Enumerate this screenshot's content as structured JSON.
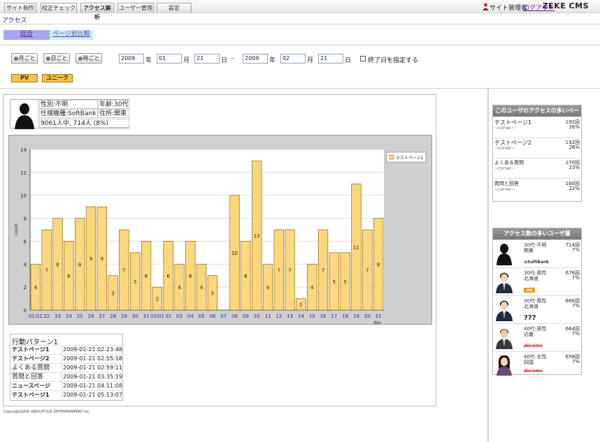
{
  "nav": {
    "tabs": [
      "サイト制作",
      "校正チェック",
      "アクセス解析",
      "ユーザー管理",
      "設定"
    ],
    "user_label": "サイト管理者",
    "logout_label": "ログアウト",
    "brand": "ZEKE CMS"
  },
  "section_title": "アクセス",
  "subtabs": [
    "総合",
    "ページ別比較"
  ],
  "filters": {
    "period_buttons": [
      "月ごと",
      "日ごと",
      "時ごと"
    ],
    "from": {
      "year": "2009",
      "month": "01",
      "day": "21"
    },
    "to": {
      "year": "2009",
      "month": "02",
      "day": "21"
    },
    "year_label": "年",
    "month_label": "月",
    "day_label": "日",
    "dash": "–",
    "enddate_label": "終了日を指定する",
    "metric_buttons": [
      "PV",
      "ユニーク"
    ]
  },
  "profile": {
    "gender": "性別:不明",
    "age": "年齢:30代",
    "device": "仕様機種:SoftBank",
    "address": "住所:関東",
    "summary": "9061人中, 714人 (8%)"
  },
  "chart_data": {
    "type": "bar",
    "categories": [
      "01/21",
      "22",
      "23",
      "24",
      "25",
      "26",
      "27",
      "28",
      "29",
      "30",
      "31",
      "02/01",
      "02",
      "03",
      "04",
      "05",
      "06",
      "07",
      "08",
      "09",
      "10",
      "11",
      "12",
      "13",
      "14",
      "15",
      "16",
      "17",
      "18",
      "19",
      "20",
      "21"
    ],
    "values": [
      4,
      7,
      8,
      6,
      8,
      9,
      9,
      3,
      7,
      5,
      6,
      2,
      6,
      4,
      6,
      4,
      3,
      0,
      10,
      6,
      13,
      4,
      7,
      7,
      1,
      4,
      7,
      5,
      5,
      11,
      7,
      8
    ],
    "series_name": "テストページ1",
    "xlabel": "day",
    "ylabel": "count",
    "ylim": [
      0,
      14
    ],
    "yticks": [
      0,
      2,
      4,
      6,
      8,
      10,
      12,
      14
    ],
    "bar_color": "#fcd77c",
    "legend": "top-right",
    "grid": true
  },
  "activity": {
    "title": "行動パターン1",
    "rows": [
      {
        "page": "テストページ1",
        "time": "2009-01-21 02:23:48"
      },
      {
        "page": "テストページ2",
        "time": "2009-01-21 02:55:18"
      },
      {
        "page": "よくある質問",
        "time": "2009-01-21 02:59:11"
      },
      {
        "page": "質問と回答",
        "time": "2009-01-21 03:35:19"
      },
      {
        "page": "ニュースページ",
        "time": "2009-01-21 04:11:08"
      },
      {
        "page": "テストページ1",
        "time": "2009-01-21 05:13:07"
      }
    ]
  },
  "copyright": "Copyright2006 UBIQUITOUS ENTERTAINMENT Inc.",
  "popular_pages": {
    "title": "このユーザのアクセスの多いページ",
    "items": [
      {
        "name": "テストページ1",
        "corner": "~corner~",
        "count": "192回",
        "pct": "26%"
      },
      {
        "name": "テストページ2",
        "corner": "~corner~",
        "count": "192回",
        "pct": "26%"
      },
      {
        "name": "よくある質問",
        "corner": "~corner~",
        "count": "170回",
        "pct": "23%"
      },
      {
        "name": "質問と回答",
        "corner": "~corner~",
        "count": "160回",
        "pct": "22%"
      }
    ]
  },
  "user_segments": {
    "title": "アクセス数の多いユーザ層",
    "items": [
      {
        "l1": "30代-不明",
        "l2": "関東",
        "count": "714回",
        "pct": "7%",
        "carrier": "≡SoftBank",
        "carrier_color": "#333333"
      },
      {
        "l1": "30代-男性",
        "l2": "北海道",
        "count": "676回",
        "pct": "7%",
        "carrier": "au",
        "carrier_color": "#f39800"
      },
      {
        "l1": "30代-男性",
        "l2": "北海道",
        "count": "666回",
        "pct": "7%",
        "carrier": "???",
        "carrier_color": "#111111"
      },
      {
        "l1": "40代-男性",
        "l2": "近畿",
        "count": "664回",
        "pct": "7%",
        "carrier": "docomo",
        "carrier_color": "#d8000f"
      },
      {
        "l1": "40代-女性",
        "l2": "四国",
        "count": "658回",
        "pct": "7%",
        "carrier": "docomo",
        "carrier_color": "#d8000f"
      }
    ]
  }
}
